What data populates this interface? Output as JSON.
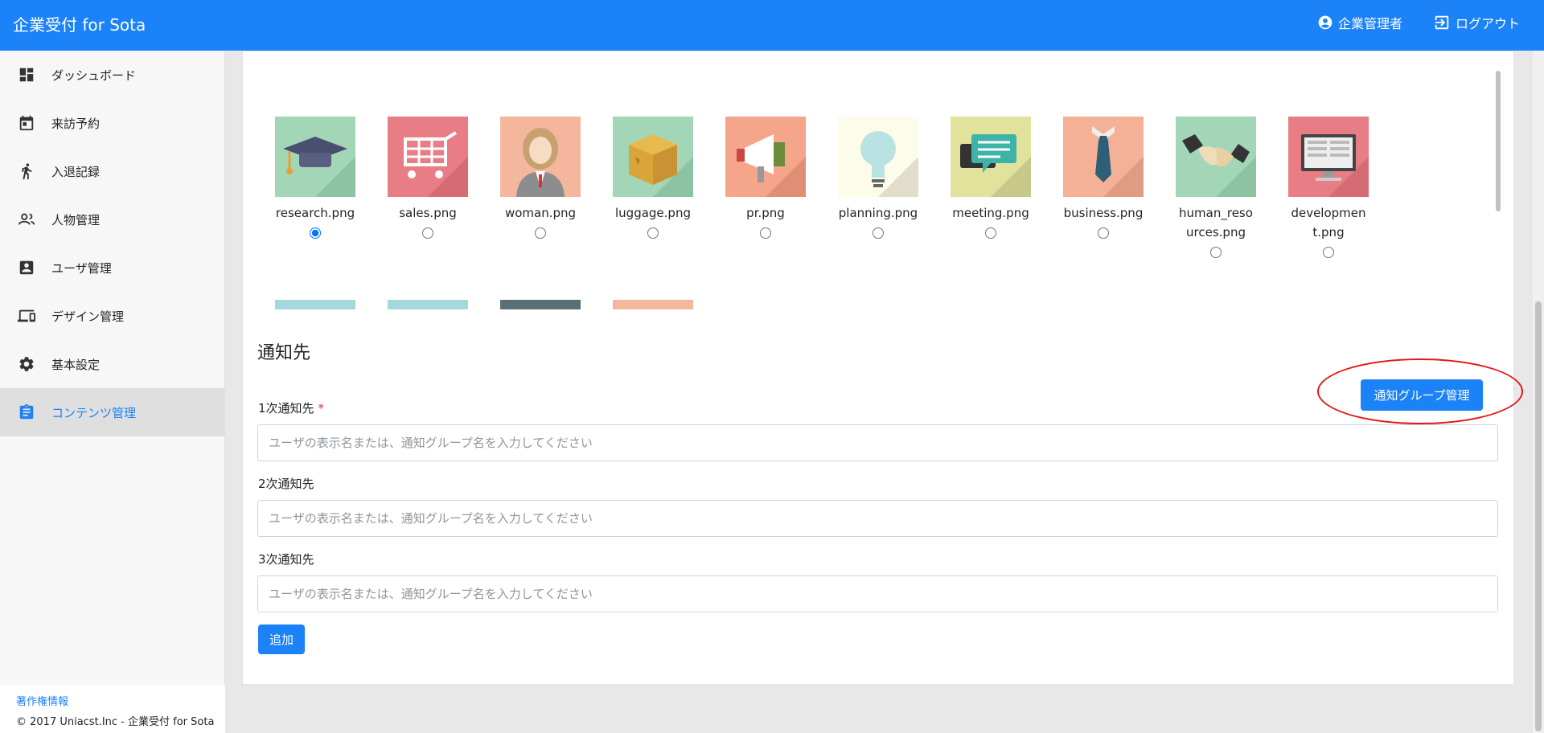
{
  "header": {
    "title": "企業受付 for Sota",
    "user_label": "企業管理者",
    "logout_label": "ログアウト"
  },
  "sidebar": {
    "items": [
      {
        "label": "ダッシュボード",
        "icon": "dashboard-icon"
      },
      {
        "label": "来訪予約",
        "icon": "calendar-icon"
      },
      {
        "label": "入退記録",
        "icon": "walk-icon"
      },
      {
        "label": "人物管理",
        "icon": "people-icon"
      },
      {
        "label": "ユーザ管理",
        "icon": "account-box-icon"
      },
      {
        "label": "デザイン管理",
        "icon": "devices-icon"
      },
      {
        "label": "基本設定",
        "icon": "gear-icon"
      },
      {
        "label": "コンテンツ管理",
        "icon": "clipboard-icon"
      }
    ],
    "active_index": 7,
    "footer": {
      "copyright_link": "著作権情報",
      "copyright_text": "© 2017 Uniacst.Inc - 企業受付 for Sota"
    }
  },
  "images": {
    "items": [
      {
        "name": "research.png",
        "selected": true,
        "bg": "#a2d6b6"
      },
      {
        "name": "sales.png",
        "selected": false,
        "bg": "#e87d86"
      },
      {
        "name": "woman.png",
        "selected": false,
        "bg": "#f4b79e"
      },
      {
        "name": "luggage.png",
        "selected": false,
        "bg": "#a2d6b6"
      },
      {
        "name": "pr.png",
        "selected": false,
        "bg": "#f4a58a"
      },
      {
        "name": "planning.png",
        "selected": false,
        "bg": "#fdfbea"
      },
      {
        "name": "meeting.png",
        "selected": false,
        "bg": "#e1e29c"
      },
      {
        "name": "business.png",
        "selected": false,
        "bg": "#f4b196"
      },
      {
        "name": "human_resources.png",
        "selected": false,
        "bg": "#a2d6b6"
      },
      {
        "name": "development.png",
        "selected": false,
        "bg": "#e87d86"
      }
    ],
    "next_row_colors": [
      "#a3d9dc",
      "#a3d9dc",
      "#5a6e78",
      "#f4b79e"
    ]
  },
  "notify": {
    "section_title": "通知先",
    "group_button": "通知グループ管理",
    "fields": [
      {
        "label": "1次通知先",
        "required": true,
        "placeholder": "ユーザの表示名または、通知グループ名を入力してください"
      },
      {
        "label": "2次通知先",
        "required": false,
        "placeholder": "ユーザの表示名または、通知グループ名を入力してください"
      },
      {
        "label": "3次通知先",
        "required": false,
        "placeholder": "ユーザの表示名または、通知グループ名を入力してください"
      }
    ],
    "required_mark": "*",
    "add_button": "追加"
  },
  "colors": {
    "accent": "#1b82f7",
    "highlight_ellipse": "#e4161b"
  }
}
